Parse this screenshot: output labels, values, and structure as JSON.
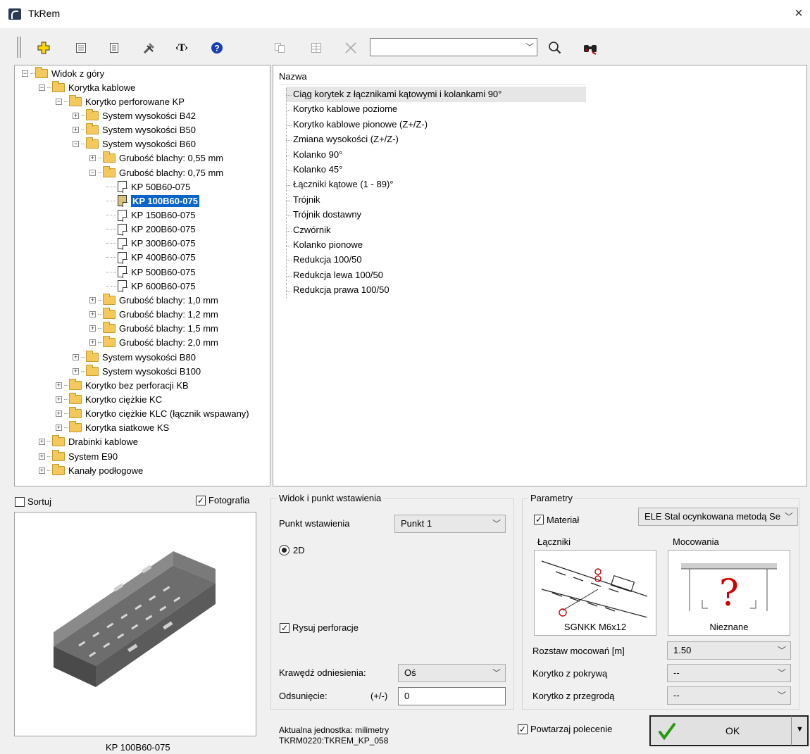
{
  "window": {
    "title": "TkRem",
    "close": "×"
  },
  "toolbar": {
    "search_value": "",
    "icons": [
      "add-icon",
      "grid-icon",
      "list-icon",
      "tools-icon",
      "text-tag-icon",
      "help-icon",
      "copy-icon",
      "table-icon",
      "delete-icon",
      "search-icon",
      "binoculars-icon"
    ],
    "text_tag": "‹T›"
  },
  "tree": [
    {
      "label": "Widok z góry",
      "level": 0,
      "kind": "folder",
      "exp": "-"
    },
    {
      "label": "Korytka kablowe",
      "level": 1,
      "kind": "folder",
      "exp": "-"
    },
    {
      "label": "Korytko perforowane KP",
      "level": 2,
      "kind": "folder",
      "exp": "-"
    },
    {
      "label": "System wysokości B42",
      "level": 3,
      "kind": "folder",
      "exp": "+"
    },
    {
      "label": "System wysokości B50",
      "level": 3,
      "kind": "folder",
      "exp": "+"
    },
    {
      "label": "System wysokości B60",
      "level": 3,
      "kind": "folder",
      "exp": "-"
    },
    {
      "label": "Grubość blachy: 0,55 mm",
      "level": 4,
      "kind": "folder",
      "exp": "+"
    },
    {
      "label": "Grubość blachy: 0,75 mm",
      "level": 4,
      "kind": "folder",
      "exp": "-"
    },
    {
      "label": "KP 50B60-075",
      "level": 5,
      "kind": "doc"
    },
    {
      "label": "KP 100B60-075",
      "level": 5,
      "kind": "doc",
      "selected": true
    },
    {
      "label": "KP 150B60-075",
      "level": 5,
      "kind": "doc"
    },
    {
      "label": "KP 200B60-075",
      "level": 5,
      "kind": "doc"
    },
    {
      "label": "KP 300B60-075",
      "level": 5,
      "kind": "doc"
    },
    {
      "label": "KP 400B60-075",
      "level": 5,
      "kind": "doc"
    },
    {
      "label": "KP 500B60-075",
      "level": 5,
      "kind": "doc"
    },
    {
      "label": "KP 600B60-075",
      "level": 5,
      "kind": "doc"
    },
    {
      "label": "Grubość blachy: 1,0 mm",
      "level": 4,
      "kind": "folder",
      "exp": "+"
    },
    {
      "label": "Grubość blachy: 1,2 mm",
      "level": 4,
      "kind": "folder",
      "exp": "+"
    },
    {
      "label": "Grubość blachy: 1,5 mm",
      "level": 4,
      "kind": "folder",
      "exp": "+"
    },
    {
      "label": "Grubość blachy: 2,0 mm",
      "level": 4,
      "kind": "folder",
      "exp": "+"
    },
    {
      "label": "System wysokości B80",
      "level": 3,
      "kind": "folder",
      "exp": "+"
    },
    {
      "label": "System wysokości B100",
      "level": 3,
      "kind": "folder",
      "exp": "+"
    },
    {
      "label": "Korytko bez perforacji KB",
      "level": 2,
      "kind": "folder",
      "exp": "+"
    },
    {
      "label": "Korytko ciężkie KC",
      "level": 2,
      "kind": "folder",
      "exp": "+"
    },
    {
      "label": "Korytko ciężkie KLC (łącznik wspawany)",
      "level": 2,
      "kind": "folder",
      "exp": "+"
    },
    {
      "label": "Korytka siatkowe KS",
      "level": 2,
      "kind": "folder",
      "exp": "+"
    },
    {
      "label": "Drabinki kablowe",
      "level": 1,
      "kind": "folder",
      "exp": "+"
    },
    {
      "label": "System E90",
      "level": 1,
      "kind": "folder",
      "exp": "+"
    },
    {
      "label": "Kanały podłogowe",
      "level": 1,
      "kind": "folder",
      "exp": "+"
    }
  ],
  "list": {
    "header": "Nazwa",
    "items": [
      "Ciąg korytek z łącznikami kątowymi i kolankami 90°",
      "Korytko kablowe poziome",
      "Korytko kablowe pionowe (Z+/Z-)",
      "Zmiana wysokości (Z+/Z-)",
      "Kolanko 90°",
      "Kolanko 45°",
      "Łączniki kątowe (1 - 89)°",
      "Trójnik",
      "Trójnik dostawny",
      "Czwórnik",
      "Kolanko pionowe",
      "Redukcja 100/50",
      "Redukcja lewa 100/50",
      "Redukcja prawa 100/50"
    ]
  },
  "left_bottom": {
    "sort_label": "Sortuj",
    "sort_checked": false,
    "photo_label": "Fotografia",
    "photo_checked": true,
    "photo_caption": "KP 100B60-075"
  },
  "view_group": {
    "title": "Widok i punkt wstawienia",
    "insert_point_label": "Punkt wstawienia",
    "insert_point_value": "Punkt 1",
    "mode_2d": "2D",
    "draw_perf_label": "Rysuj perforacje",
    "draw_perf_checked": true,
    "ref_edge_label": "Krawędź odniesienia:",
    "ref_edge_value": "Oś",
    "offset_label": "Odsunięcie:",
    "offset_sign": "(+/-)",
    "offset_value": "0"
  },
  "params_group": {
    "title": "Parametry",
    "material_label": "Materiał",
    "material_checked": true,
    "material_value": "ELE Stal ocynkowana metodą Se",
    "connectors_label": "Łączniki",
    "mounting_label": "Mocowania",
    "connector_caption": "SGNKK M6x12",
    "mounting_caption": "Nieznane",
    "spacing_label": "Rozstaw mocowań [m]",
    "spacing_value": "1.50",
    "cover_label": "Korytko z pokrywą",
    "cover_value": "--",
    "partition_label": "Korytko z przegrodą",
    "partition_value": "--"
  },
  "footer": {
    "unit": "Aktualna jednostka: milimetry",
    "code": "TKRM0220:TKREM_KP_058",
    "repeat_label": "Powtarzaj polecenie",
    "repeat_checked": true,
    "ok_label": "OK"
  }
}
